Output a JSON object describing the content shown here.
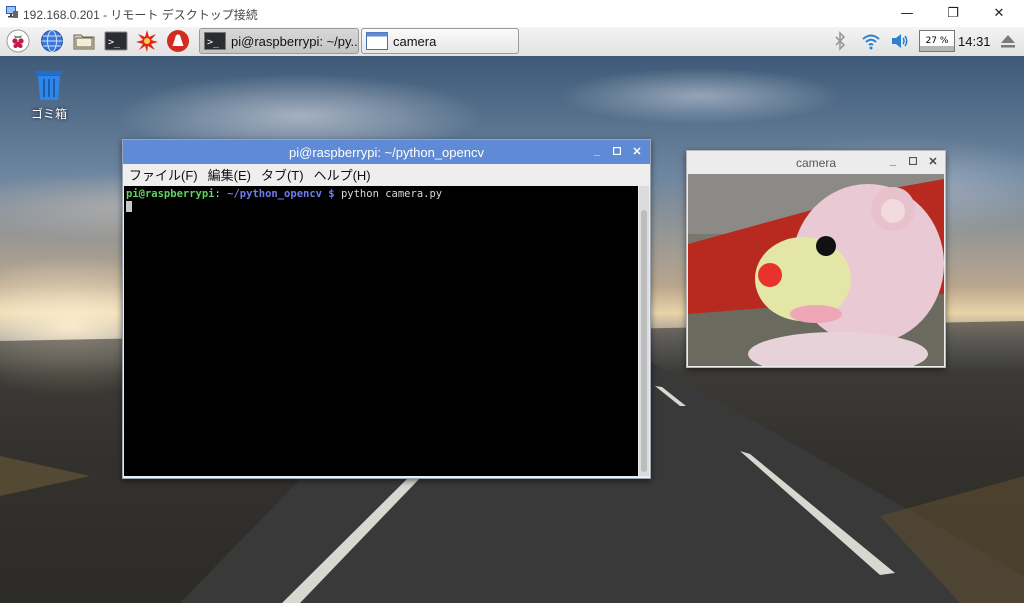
{
  "window": {
    "title": "192.168.0.201 - リモート デスクトップ接続",
    "minimize": "—",
    "maximize": "❐",
    "close": "✕"
  },
  "taskbar": {
    "launchers": [
      "raspberry-menu-icon",
      "web-browser-icon",
      "file-manager-icon",
      "terminal-icon",
      "mathematica-icon",
      "wolfram-icon"
    ],
    "tasks": [
      {
        "label": "pi@raspberrypi: ~/py...",
        "active": true
      },
      {
        "label": "camera",
        "active": false
      }
    ],
    "cpu_label": "27 %",
    "cpu_usage": 0.27,
    "clock": "14:31"
  },
  "desktop": {
    "trash_label": "ゴミ箱"
  },
  "terminal": {
    "title": "pi@raspberrypi: ~/python_opencv",
    "menus": [
      "ファイル(F)",
      "編集(E)",
      "タブ(T)",
      "ヘルプ(H)"
    ],
    "prompt_user": "pi@raspberrypi",
    "prompt_sep": ":",
    "prompt_path": " ~/python_opencv $",
    "command": " python camera.py"
  },
  "camera": {
    "title": "camera"
  },
  "colors": {
    "terminal_title_bg": "#5f8ad6",
    "prompt_user": "#5fd35f",
    "prompt_path": "#6d7cf0"
  }
}
